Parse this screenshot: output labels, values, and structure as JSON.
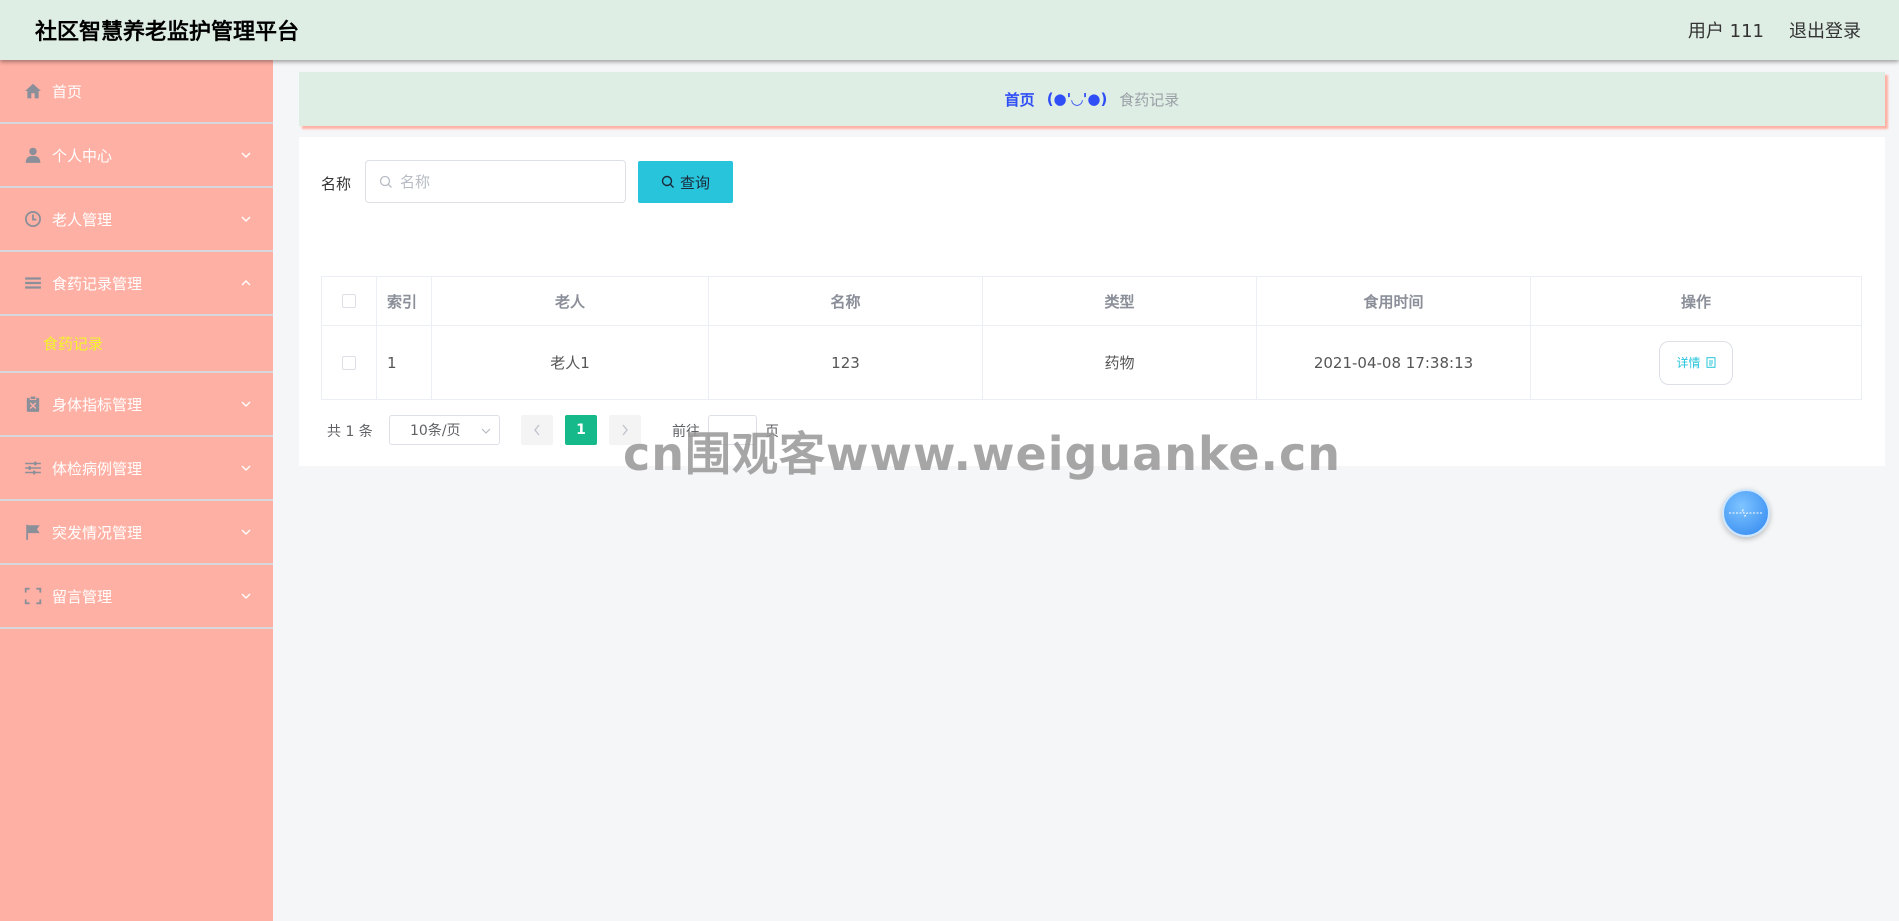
{
  "header": {
    "title": "社区智慧养老监护管理平台",
    "user_label": "用户 111",
    "logout_label": "退出登录"
  },
  "sidebar": {
    "items": [
      {
        "label": "首页",
        "icon": "home-icon"
      },
      {
        "label": "个人中心",
        "icon": "user-icon"
      },
      {
        "label": "老人管理",
        "icon": "clock-icon"
      },
      {
        "label": "食药记录管理",
        "icon": "menu-lines-icon",
        "expanded": true,
        "children": [
          {
            "label": "食药记录"
          }
        ]
      },
      {
        "label": "身体指标管理",
        "icon": "clipboard-icon"
      },
      {
        "label": "体检病例管理",
        "icon": "sliders-icon"
      },
      {
        "label": "突发情况管理",
        "icon": "flag-icon"
      },
      {
        "label": "留言管理",
        "icon": "frame-icon"
      }
    ]
  },
  "breadcrumb": {
    "home": "首页",
    "separator": "(●'◡'●)",
    "current": "食药记录"
  },
  "search": {
    "label": "名称",
    "placeholder": "名称",
    "value": "",
    "button_label": "查询"
  },
  "table": {
    "headers": [
      "索引",
      "老人",
      "名称",
      "类型",
      "食用时间",
      "操作"
    ],
    "rows": [
      {
        "index": "1",
        "elder": "老人1",
        "name": "123",
        "type": "药物",
        "time": "2021-04-08 17:38:13",
        "action": "详情"
      }
    ]
  },
  "pagination": {
    "total": "共 1 条",
    "page_size": "10条/页",
    "current_page": "1",
    "goto_label": "前往",
    "goto_value": "",
    "goto_unit": "页"
  },
  "watermark": "cn围观客www.weiguanke.cn",
  "colors": {
    "header_bg": "#dfeee5",
    "sidebar_bg": "#ffb0a4",
    "accent": "#27c4dc",
    "active_submenu": "#f3f328",
    "page_active": "#16b98a",
    "breadcrumb_home": "#304ef5"
  }
}
